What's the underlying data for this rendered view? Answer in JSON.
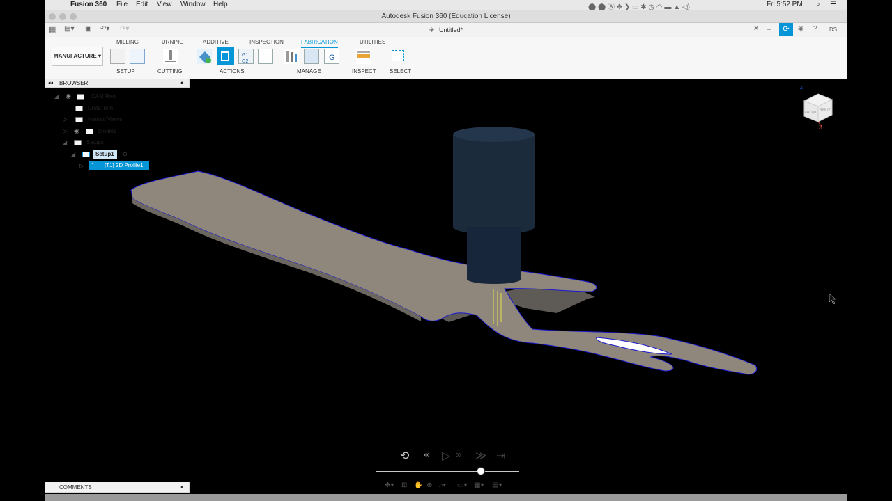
{
  "menubar": {
    "app_name": "Fusion 360",
    "items": [
      "File",
      "Edit",
      "View",
      "Window",
      "Help"
    ],
    "clock": "Fri 5:52 PM"
  },
  "window": {
    "title": "Autodesk Fusion 360 (Education License)"
  },
  "document_tab": {
    "name": "Untitled*",
    "user_initials": "DS"
  },
  "ribbon": {
    "tabs": [
      {
        "label": "MILLING",
        "active": false
      },
      {
        "label": "TURNING",
        "active": false
      },
      {
        "label": "ADDITIVE",
        "active": false
      },
      {
        "label": "INSPECTION",
        "active": false
      },
      {
        "label": "FABRICATION",
        "active": true
      },
      {
        "label": "UTILITIES",
        "active": false
      }
    ],
    "workspace": "MANUFACTURE",
    "groups": [
      "SETUP",
      "CUTTING",
      "ACTIONS",
      "MANAGE",
      "INSPECT",
      "SELECT"
    ],
    "accent": "#0696d7"
  },
  "browser": {
    "header": "BROWSER",
    "nodes": {
      "root": "CAM Root",
      "units": "Units: mm",
      "named_views": "Named Views",
      "models": "Models",
      "setups": "Setups",
      "setup1": "Setup1",
      "operation": "[T1] 2D Profile1"
    }
  },
  "viewcube": {
    "front": "FRONT",
    "right": "RIGHT",
    "z_axis": "Z",
    "x_axis": "X"
  },
  "comments": {
    "label": "COMMENTS"
  },
  "colors": {
    "part_face": "#8f877c",
    "part_edge": "#1a1ad0",
    "tool": "#1c2b3c",
    "selection": "#0696d7"
  }
}
